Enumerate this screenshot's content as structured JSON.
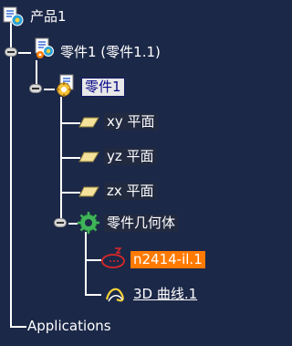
{
  "tree": {
    "root": {
      "label": "产品1",
      "icon": "product-icon"
    },
    "part_instance": {
      "label": "零件1 (零件1.1)",
      "icon": "part-instance-icon"
    },
    "part": {
      "label": "零件1",
      "icon": "part-icon",
      "selected": true
    },
    "planes": [
      {
        "label": "xy 平面",
        "icon": "plane-icon"
      },
      {
        "label": "yz 平面",
        "icon": "plane-icon"
      },
      {
        "label": "zx 平面",
        "icon": "plane-icon"
      }
    ],
    "geometry_set": {
      "label": "零件几何体",
      "icon": "geometry-set-icon"
    },
    "geometry_items": [
      {
        "label": "n2414-il.1",
        "icon": "sketch-icon",
        "highlighted": true
      },
      {
        "label": "3D 曲线.1",
        "icon": "curve-3d-icon",
        "underlined": true
      }
    ],
    "applications": {
      "label": "Applications"
    }
  },
  "colors": {
    "background": "#1c2848",
    "highlight": "#ff7a00",
    "selected_bg": "#e8e8e8"
  }
}
